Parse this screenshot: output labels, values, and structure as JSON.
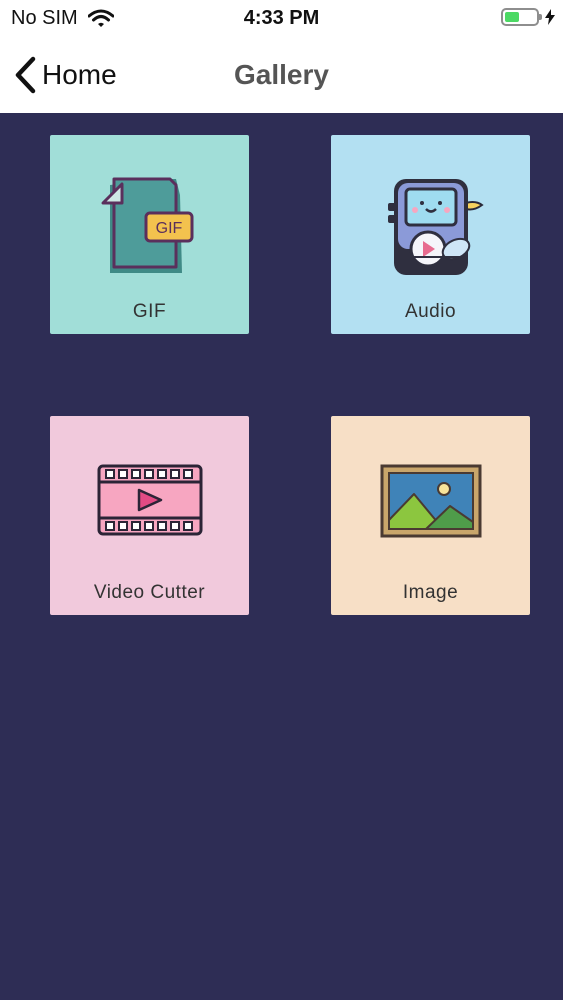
{
  "status_bar": {
    "carrier": "No SIM",
    "time": "4:33 PM"
  },
  "nav": {
    "back_label": "Home",
    "title": "Gallery"
  },
  "tiles": [
    {
      "label": "GIF",
      "icon": "gif-file-icon",
      "color": "#a1ded8"
    },
    {
      "label": "Audio",
      "icon": "music-player-icon",
      "color": "#b3e0f2"
    },
    {
      "label": "Video Cutter",
      "icon": "film-strip-icon",
      "color": "#f1c9dc"
    },
    {
      "label": "Image",
      "icon": "picture-icon",
      "color": "#f7dfc6"
    }
  ],
  "colors": {
    "background": "#2e2d55",
    "battery": "#4cd964"
  }
}
